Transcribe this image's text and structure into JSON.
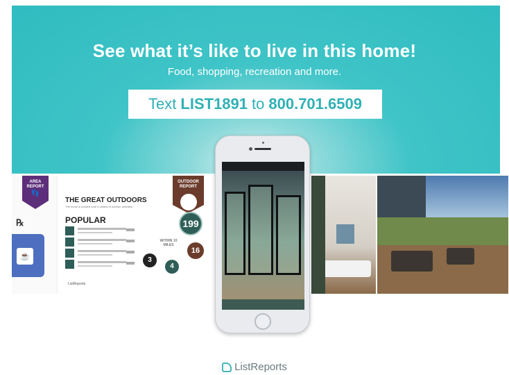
{
  "headline": "See what it’s like to live in this home!",
  "subline": "Food, shopping, recreation and more.",
  "cta": {
    "prefix": "Text",
    "code": "LIST1891",
    "middle": "to",
    "phone": "800.701.6509"
  },
  "area_report": {
    "ribbon": "AREA REPORT",
    "icon": "footprints-icon",
    "rx_symbol": "℞"
  },
  "outdoor_report": {
    "ribbon": "OUTDOOR REPORT",
    "title": "THE GREAT OUTDOORS",
    "subtitle": "The home is located near a variety of outdoor activities",
    "section": "POPULAR",
    "within_label": "WITHIN 10 MILES",
    "counts": [
      "199",
      "16",
      "3",
      "4"
    ],
    "footer": "ListReports"
  },
  "brand": {
    "name": "ListReports",
    "accent": "#2fbcc0"
  }
}
